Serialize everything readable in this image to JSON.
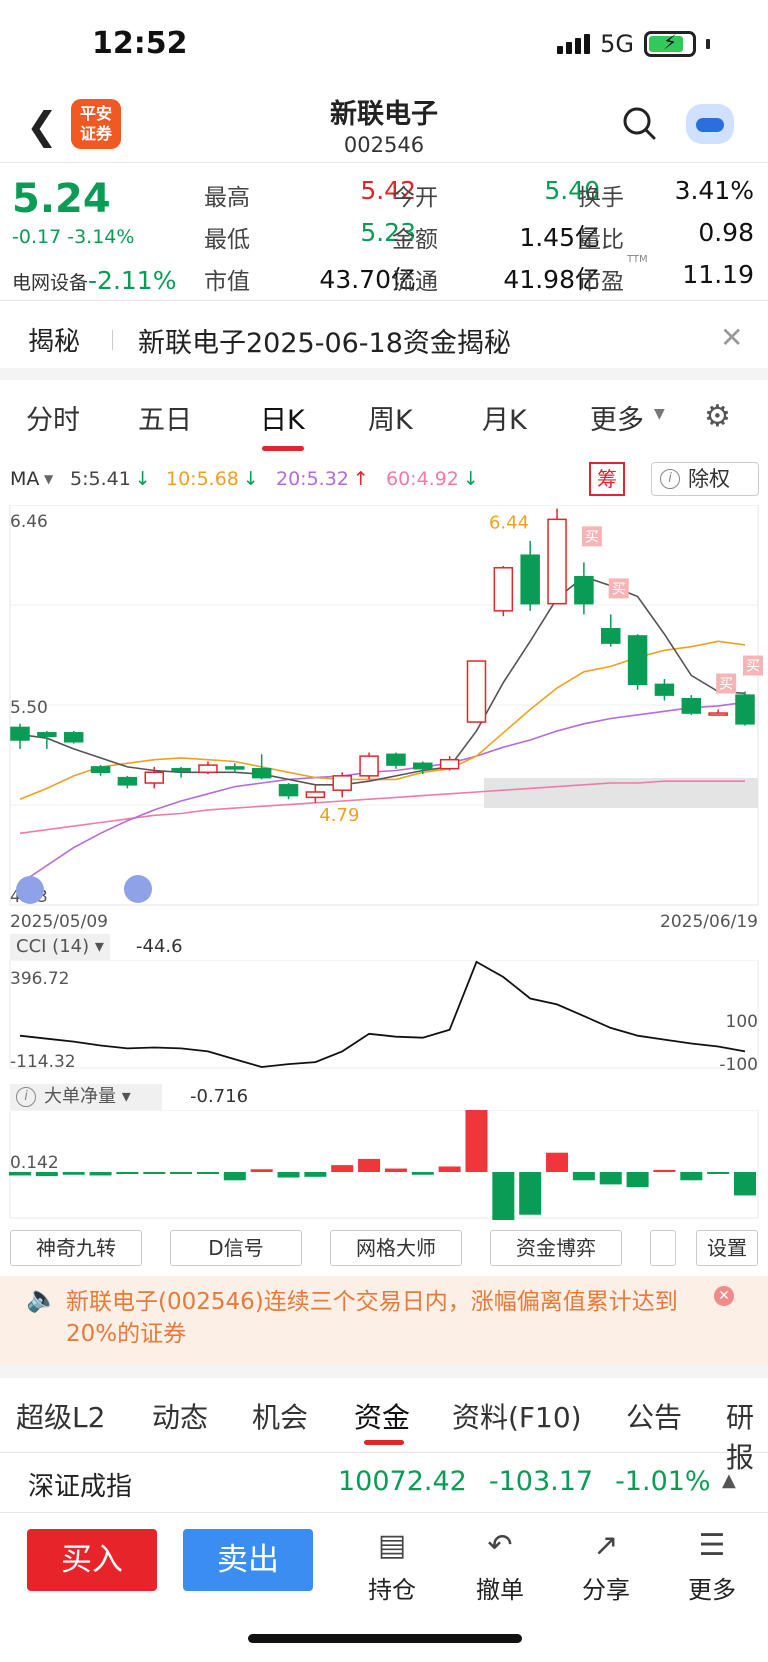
{
  "status": {
    "time": "12:52",
    "network": "5G"
  },
  "header": {
    "logo_line1": "平安",
    "logo_line2": "证券",
    "stock_name": "新联电子",
    "stock_code": "002546"
  },
  "quote": {
    "price": "5.24",
    "change": "-0.17",
    "change_pct": "-3.14%",
    "sector_name": "电网设备",
    "sector_pct": "-2.11%",
    "fields": [
      {
        "label": "最高",
        "value": "5.42",
        "color": "red"
      },
      {
        "label": "今开",
        "value": "5.40",
        "color": "green"
      },
      {
        "label": "换手",
        "value": "3.41%",
        "color": "black"
      },
      {
        "label": "最低",
        "value": "5.23",
        "color": "green"
      },
      {
        "label": "金额",
        "value": "1.45亿",
        "color": "black"
      },
      {
        "label": "量比",
        "value": "0.98",
        "color": "black"
      },
      {
        "label": "市值",
        "value": "43.70亿",
        "color": "black"
      },
      {
        "label": "流通",
        "value": "41.98亿",
        "color": "black"
      },
      {
        "label": "市盈",
        "value": "11.19",
        "color": "black",
        "sup": "TTM"
      }
    ]
  },
  "notice": {
    "tag": "揭秘",
    "text": "新联电子2025-06-18资金揭秘"
  },
  "kline_tabs": [
    "分时",
    "五日",
    "日K",
    "周K",
    "月K",
    "更多"
  ],
  "ma": {
    "label": "MA",
    "items": [
      {
        "text": "5:5.41",
        "arrow": "↓",
        "color": "#444444"
      },
      {
        "text": "10:5.68",
        "arrow": "↓",
        "color": "#f0a020"
      },
      {
        "text": "20:5.32",
        "arrow": "↑",
        "color": "#b46ae0"
      },
      {
        "text": "60:4.92",
        "arrow": "↓",
        "color": "#f07aa8"
      }
    ],
    "chou": "筹",
    "chuquan": "除权"
  },
  "chart_data": {
    "type": "candlestick",
    "y_max_label": "6.46",
    "y_mid_label": "5.50",
    "y_min_label": "4.23",
    "start_date": "2025/05/09",
    "end_date": "2025/06/19",
    "high_label": "6.44",
    "low_label": "4.79",
    "candles": [
      {
        "o": 5.22,
        "c": 5.15,
        "h": 5.24,
        "l": 5.1
      },
      {
        "o": 5.19,
        "c": 5.17,
        "h": 5.2,
        "l": 5.1
      },
      {
        "o": 5.19,
        "c": 5.14,
        "h": 5.2,
        "l": 5.13
      },
      {
        "o": 5.0,
        "c": 4.97,
        "h": 5.01,
        "l": 4.95
      },
      {
        "o": 4.94,
        "c": 4.9,
        "h": 4.95,
        "l": 4.88
      },
      {
        "o": 4.91,
        "c": 4.97,
        "h": 5.0,
        "l": 4.88
      },
      {
        "o": 4.99,
        "c": 4.98,
        "h": 5.0,
        "l": 4.94
      },
      {
        "o": 4.97,
        "c": 5.01,
        "h": 5.03,
        "l": 4.96
      },
      {
        "o": 5.0,
        "c": 4.99,
        "h": 5.02,
        "l": 4.97
      },
      {
        "o": 4.99,
        "c": 4.94,
        "h": 5.07,
        "l": 4.93
      },
      {
        "o": 4.9,
        "c": 4.84,
        "h": 4.91,
        "l": 4.82
      },
      {
        "o": 4.83,
        "c": 4.86,
        "h": 4.9,
        "l": 4.8
      },
      {
        "o": 4.87,
        "c": 4.95,
        "h": 4.97,
        "l": 4.83
      },
      {
        "o": 4.95,
        "c": 5.06,
        "h": 5.08,
        "l": 4.93
      },
      {
        "o": 5.07,
        "c": 5.01,
        "h": 5.08,
        "l": 4.99
      },
      {
        "o": 5.02,
        "c": 4.99,
        "h": 5.03,
        "l": 4.96
      },
      {
        "o": 4.99,
        "c": 5.04,
        "h": 5.06,
        "l": 4.98
      },
      {
        "o": 5.25,
        "c": 5.59,
        "h": 5.59,
        "l": 5.25
      },
      {
        "o": 5.87,
        "c": 6.11,
        "h": 6.12,
        "l": 5.84
      },
      {
        "o": 6.18,
        "c": 5.91,
        "h": 6.26,
        "l": 5.87
      },
      {
        "o": 5.91,
        "c": 6.38,
        "h": 6.44,
        "l": 5.91
      },
      {
        "o": 6.06,
        "c": 5.91,
        "h": 6.14,
        "l": 5.85
      },
      {
        "o": 5.77,
        "c": 5.69,
        "h": 5.85,
        "l": 5.67
      },
      {
        "o": 5.73,
        "c": 5.46,
        "h": 5.74,
        "l": 5.43
      },
      {
        "o": 5.46,
        "c": 5.4,
        "h": 5.49,
        "l": 5.37
      },
      {
        "o": 5.38,
        "c": 5.3,
        "h": 5.4,
        "l": 5.29
      },
      {
        "o": 5.3,
        "c": 5.3,
        "h": 5.32,
        "l": 5.29
      },
      {
        "o": 5.4,
        "c": 5.24,
        "h": 5.42,
        "l": 5.23
      }
    ],
    "ma5": [
      5.18,
      5.16,
      5.1,
      5.05,
      5.0,
      4.98,
      4.97,
      4.97,
      4.97,
      4.96,
      4.93,
      4.9,
      4.9,
      4.92,
      4.95,
      4.98,
      5.0,
      5.2,
      5.47,
      5.7,
      5.94,
      6.06,
      6.01,
      5.95,
      5.74,
      5.51,
      5.42,
      5.41
    ],
    "ma10": [
      4.82,
      4.88,
      4.95,
      5.0,
      5.02,
      5.04,
      5.05,
      5.04,
      5.03,
      5.0,
      4.97,
      4.94,
      4.93,
      4.93,
      4.93,
      4.97,
      4.99,
      5.06,
      5.19,
      5.32,
      5.44,
      5.53,
      5.56,
      5.61,
      5.65,
      5.67,
      5.7,
      5.68
    ],
    "ma20": [
      4.35,
      4.45,
      4.55,
      4.63,
      4.7,
      4.76,
      4.81,
      4.85,
      4.89,
      4.91,
      4.93,
      4.94,
      4.95,
      4.97,
      4.98,
      5.0,
      5.02,
      5.06,
      5.11,
      5.15,
      5.2,
      5.24,
      5.27,
      5.29,
      5.31,
      5.33,
      5.34,
      5.36
    ],
    "ma60": [
      4.63,
      4.65,
      4.67,
      4.69,
      4.71,
      4.73,
      4.74,
      4.76,
      4.77,
      4.78,
      4.79,
      4.8,
      4.81,
      4.82,
      4.83,
      4.84,
      4.85,
      4.86,
      4.87,
      4.88,
      4.89,
      4.9,
      4.91,
      4.91,
      4.92,
      4.92,
      4.92,
      4.92
    ],
    "buy_markers": [
      21,
      22,
      26,
      27
    ],
    "cci": {
      "label": "CCI (14)",
      "value": "-44.6",
      "max_label": "396.72",
      "min_label": "-114.32",
      "level_100": "100",
      "level_neg100": "-100",
      "values": [
        20,
        5,
        -10,
        -30,
        -45,
        -40,
        -45,
        -60,
        -100,
        -140,
        -125,
        -115,
        -60,
        30,
        15,
        10,
        50,
        397,
        320,
        210,
        180,
        120,
        60,
        20,
        0,
        -20,
        -35,
        -60
      ]
    },
    "net_vol": {
      "label": "大单净量",
      "value": "-0.716",
      "level_label": "0.142",
      "values": [
        -0.05,
        -0.06,
        -0.04,
        -0.05,
        -0.03,
        -0.02,
        -0.02,
        -0.01,
        -0.12,
        0.04,
        -0.08,
        -0.07,
        0.1,
        0.19,
        0.05,
        -0.04,
        0.08,
        0.9,
        -0.72,
        -0.62,
        0.28,
        -0.12,
        -0.18,
        -0.22,
        0.03,
        -0.12,
        -0.02,
        -0.34
      ]
    }
  },
  "tools": [
    "神奇九转",
    "D信号",
    "网格大师",
    "资金博弈",
    "",
    "设置"
  ],
  "alert": {
    "text": "新联电子(002546)连续三个交易日内，涨幅偏离值累计达到20%的证券"
  },
  "bottom_tabs": [
    "超级L2",
    "动态",
    "机会",
    "资金",
    "资料(F10)",
    "公告",
    "研报"
  ],
  "index": {
    "name": "深证成指",
    "value": "10072.42",
    "change": "-103.17",
    "pct": "-1.01%"
  },
  "actions": {
    "buy": "买入",
    "sell": "卖出",
    "items": [
      "持仓",
      "撤单",
      "分享",
      "更多"
    ]
  },
  "buy_marker_text": "买"
}
